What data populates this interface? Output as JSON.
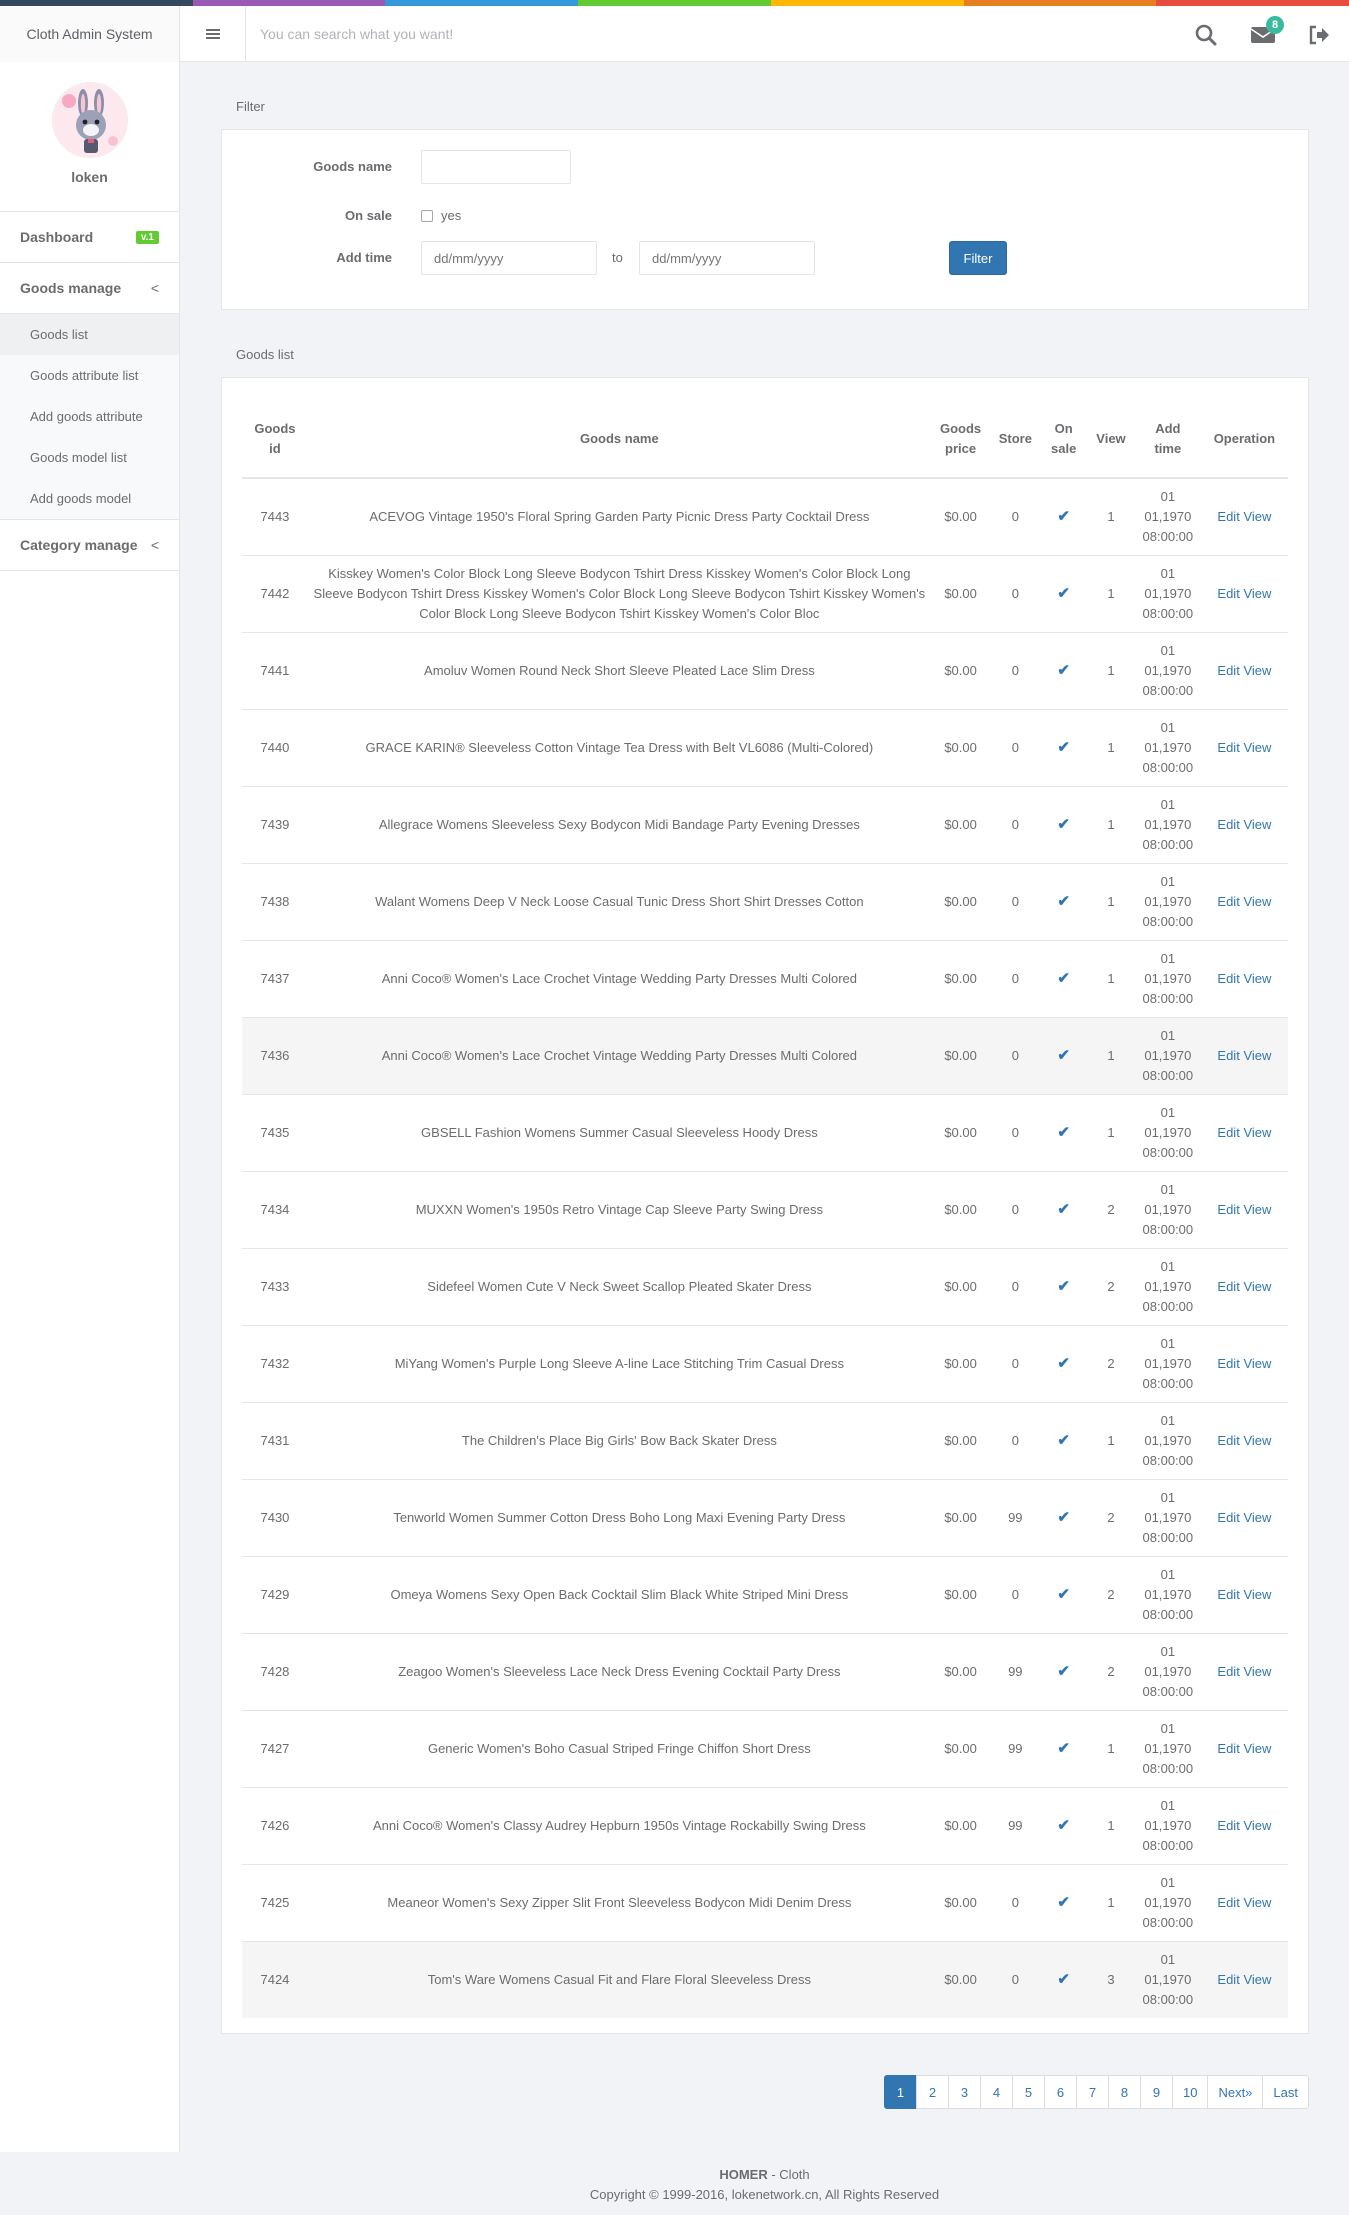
{
  "app": {
    "brand": "Cloth Admin System",
    "search_placeholder": "You can search what you want!",
    "mail_count": "8",
    "color_line": [
      "#34495e",
      "#9b59b6",
      "#3498db",
      "#62cb31",
      "#ffb606",
      "#e67e22",
      "#e74c3c"
    ]
  },
  "sidebar": {
    "username": "loken",
    "dashboard": {
      "label": "Dashboard",
      "badge": "v.1"
    },
    "goods_manage": {
      "label": "Goods manage",
      "chevron": "<"
    },
    "goods_items": [
      {
        "label": "Goods list"
      },
      {
        "label": "Goods attribute list"
      },
      {
        "label": "Add goods attribute"
      },
      {
        "label": "Goods model list"
      },
      {
        "label": "Add goods model"
      }
    ],
    "category_manage": {
      "label": "Category manage",
      "chevron": "<"
    }
  },
  "filter": {
    "title": "Filter",
    "goods_name_label": "Goods name",
    "goods_name_value": "",
    "on_sale_label": "On sale",
    "on_sale_option": "yes",
    "add_time_label": "Add time",
    "date_from_placeholder": "dd/mm/yyyy",
    "date_to_placeholder": "dd/mm/yyyy",
    "to_label": "to",
    "button": "Filter"
  },
  "goods_list": {
    "title": "Goods list",
    "headers": {
      "id_line1": "Goods",
      "id_line2": "id",
      "name": "Goods name",
      "price_line1": "Goods",
      "price_line2": "price",
      "store": "Store",
      "onsale_line1": "On",
      "onsale_line2": "sale",
      "view": "View",
      "addtime_line1": "Add",
      "addtime_line2": "time",
      "operation": "Operation"
    },
    "edit_label": "Edit",
    "view_label": "View",
    "time_line1": "01",
    "time_line2": "01,1970",
    "time_line3": "08:00:00",
    "rows": [
      {
        "id": "7443",
        "name": "ACEVOG Vintage 1950's Floral Spring Garden Party Picnic Dress Party Cocktail Dress",
        "price": "$0.00",
        "store": "0",
        "view": "1"
      },
      {
        "id": "7442",
        "name": "Kisskey Women's Color Block Long Sleeve Bodycon Tshirt Dress Kisskey Women's Color Block Long Sleeve Bodycon Tshirt Dress Kisskey Women's Color Block Long Sleeve Bodycon Tshirt Kisskey Women's Color Block Long Sleeve Bodycon Tshirt Kisskey Women's Color Bloc",
        "price": "$0.00",
        "store": "0",
        "view": "1"
      },
      {
        "id": "7441",
        "name": "Amoluv Women Round Neck Short Sleeve Pleated Lace Slim Dress",
        "price": "$0.00",
        "store": "0",
        "view": "1"
      },
      {
        "id": "7440",
        "name": "GRACE KARIN® Sleeveless Cotton Vintage Tea Dress with Belt VL6086 (Multi-Colored)",
        "price": "$0.00",
        "store": "0",
        "view": "1"
      },
      {
        "id": "7439",
        "name": "Allegrace Womens Sleeveless Sexy Bodycon Midi Bandage Party Evening Dresses",
        "price": "$0.00",
        "store": "0",
        "view": "1"
      },
      {
        "id": "7438",
        "name": "Walant Womens Deep V Neck Loose Casual Tunic Dress Short Shirt Dresses Cotton",
        "price": "$0.00",
        "store": "0",
        "view": "1"
      },
      {
        "id": "7437",
        "name": "Anni Coco® Women's Lace Crochet Vintage Wedding Party Dresses Multi Colored",
        "price": "$0.00",
        "store": "0",
        "view": "1"
      },
      {
        "id": "7436",
        "name": "Anni Coco® Women's Lace Crochet Vintage Wedding Party Dresses Multi Colored",
        "price": "$0.00",
        "store": "0",
        "view": "1"
      },
      {
        "id": "7435",
        "name": "GBSELL Fashion Womens Summer Casual Sleeveless Hoody Dress",
        "price": "$0.00",
        "store": "0",
        "view": "1"
      },
      {
        "id": "7434",
        "name": "MUXXN Women's 1950s Retro Vintage Cap Sleeve Party Swing Dress",
        "price": "$0.00",
        "store": "0",
        "view": "2"
      },
      {
        "id": "7433",
        "name": "Sidefeel Women Cute V Neck Sweet Scallop Pleated Skater Dress",
        "price": "$0.00",
        "store": "0",
        "view": "2"
      },
      {
        "id": "7432",
        "name": "MiYang Women's Purple Long Sleeve A-line Lace Stitching Trim Casual Dress",
        "price": "$0.00",
        "store": "0",
        "view": "2"
      },
      {
        "id": "7431",
        "name": "The Children's Place Big Girls' Bow Back Skater Dress",
        "price": "$0.00",
        "store": "0",
        "view": "1"
      },
      {
        "id": "7430",
        "name": "Tenworld Women Summer Cotton Dress Boho Long Maxi Evening Party Dress",
        "price": "$0.00",
        "store": "99",
        "view": "2"
      },
      {
        "id": "7429",
        "name": "Omeya Womens Sexy Open Back Cocktail Slim Black White Striped Mini Dress",
        "price": "$0.00",
        "store": "0",
        "view": "2"
      },
      {
        "id": "7428",
        "name": "Zeagoo Women's Sleeveless Lace Neck Dress Evening Cocktail Party Dress",
        "price": "$0.00",
        "store": "99",
        "view": "2"
      },
      {
        "id": "7427",
        "name": "Generic Women's Boho Casual Striped Fringe Chiffon Short Dress",
        "price": "$0.00",
        "store": "99",
        "view": "1"
      },
      {
        "id": "7426",
        "name": "Anni Coco® Women's Classy Audrey Hepburn 1950s Vintage Rockabilly Swing Dress",
        "price": "$0.00",
        "store": "99",
        "view": "1"
      },
      {
        "id": "7425",
        "name": "Meaneor Women's Sexy Zipper Slit Front Sleeveless Bodycon Midi Denim Dress",
        "price": "$0.00",
        "store": "0",
        "view": "1"
      },
      {
        "id": "7424",
        "name": "Tom's Ware Womens Casual Fit and Flare Floral Sleeveless Dress",
        "price": "$0.00",
        "store": "0",
        "view": "3"
      }
    ]
  },
  "pagination": [
    "1",
    "2",
    "3",
    "4",
    "5",
    "6",
    "7",
    "8",
    "9",
    "10",
    "Next»",
    "Last"
  ],
  "pagination_active": "1",
  "footer": {
    "brand": "HOMER",
    "brand_suffix": " - Cloth",
    "copyright": "Copyright © 1999-2016, lokenetwork.cn, All Rights Reserved"
  }
}
